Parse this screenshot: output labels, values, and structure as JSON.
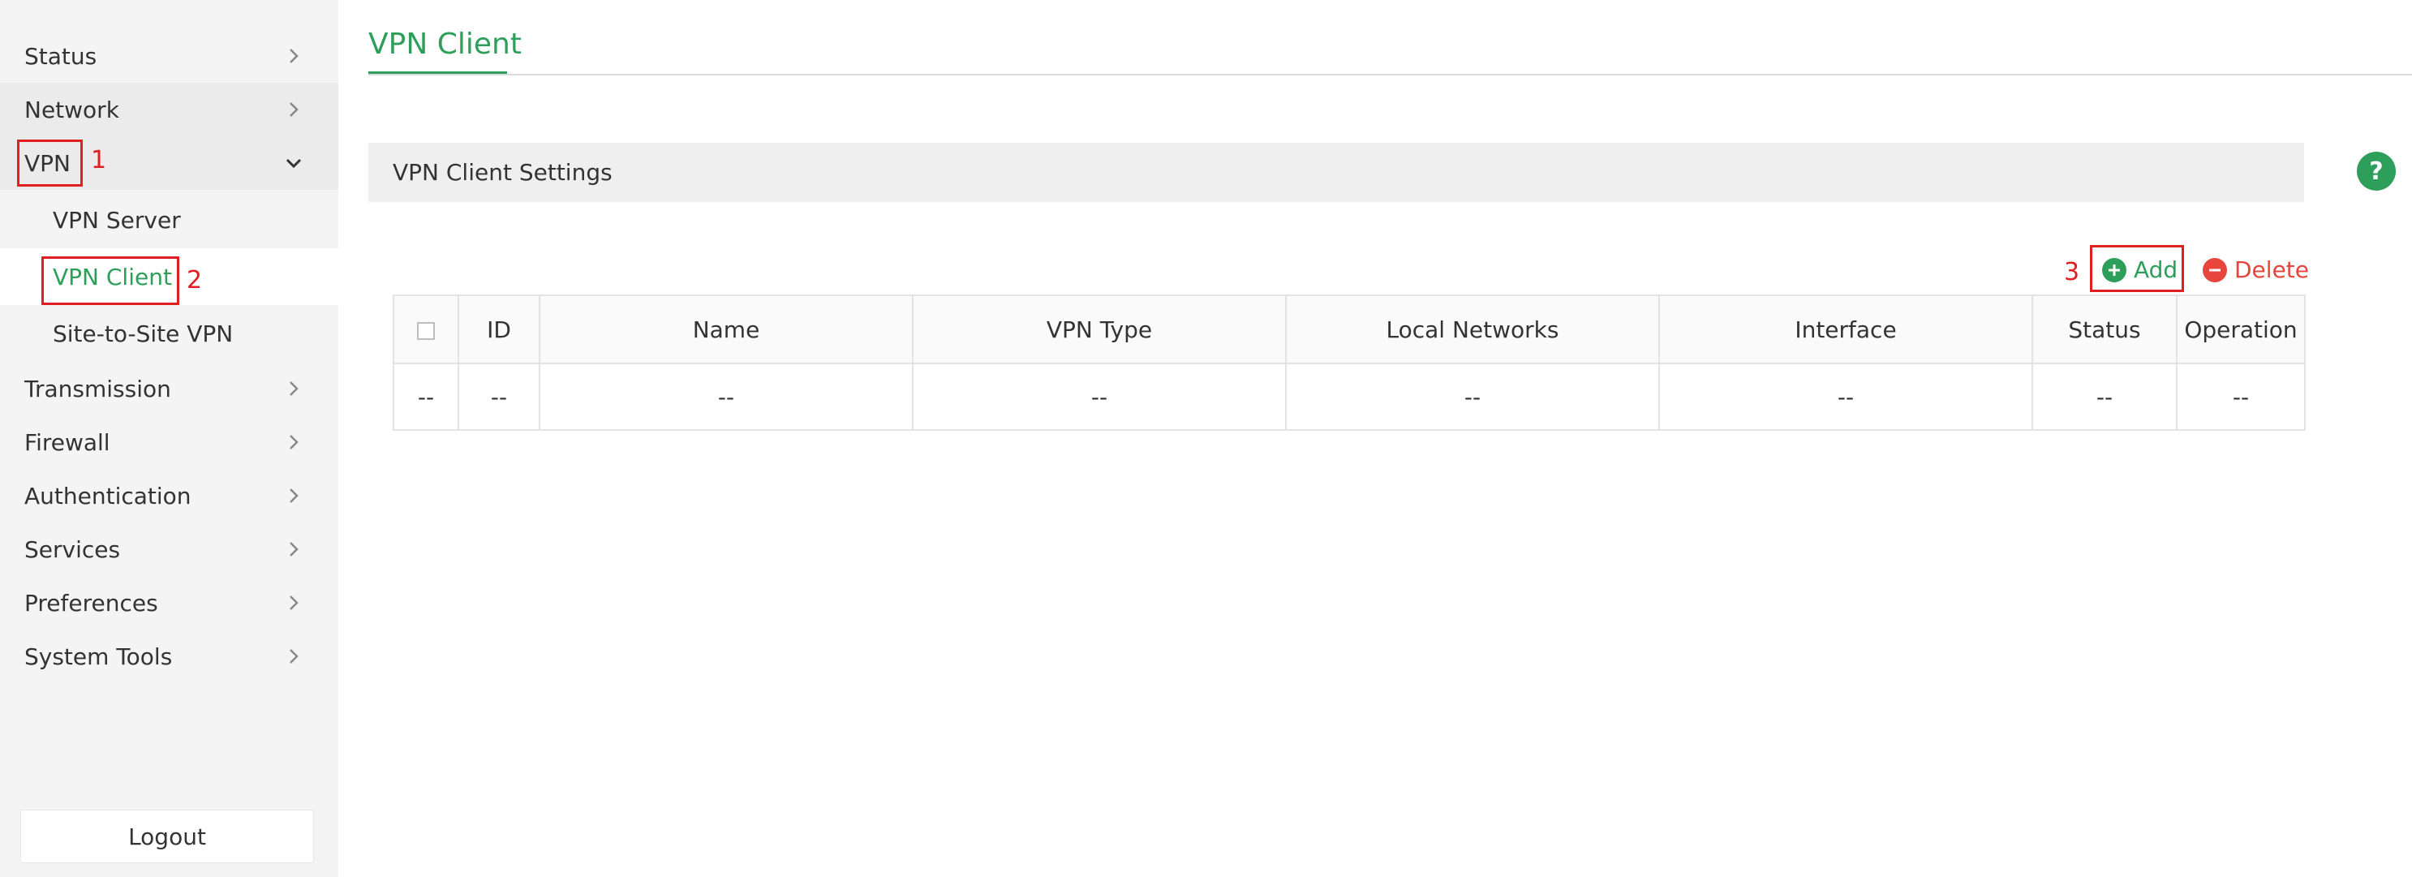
{
  "sidebar": {
    "items": [
      {
        "label": "Status"
      },
      {
        "label": "Network"
      },
      {
        "label": "VPN"
      },
      {
        "label": "Transmission"
      },
      {
        "label": "Firewall"
      },
      {
        "label": "Authentication"
      },
      {
        "label": "Services"
      },
      {
        "label": "Preferences"
      },
      {
        "label": "System Tools"
      }
    ],
    "vpn_sub": [
      {
        "label": "VPN Server"
      },
      {
        "label": "VPN Client"
      },
      {
        "label": "Site-to-Site VPN"
      }
    ],
    "logout_label": "Logout"
  },
  "annotations": {
    "step1": "1",
    "step2": "2",
    "step3": "3"
  },
  "main": {
    "tab_title": "VPN Client",
    "section_title": "VPN Client Settings",
    "help_glyph": "?",
    "actions": {
      "add_label": "Add",
      "delete_label": "Delete"
    },
    "table": {
      "headers": [
        "ID",
        "Name",
        "VPN Type",
        "Local Networks",
        "Interface",
        "Status",
        "Operation"
      ],
      "row": [
        "--",
        "--",
        "--",
        "--",
        "--",
        "--",
        "--",
        "--"
      ]
    }
  },
  "colors": {
    "accent": "#2e9e5b",
    "danger": "#e8453c",
    "annotation": "#e02020"
  }
}
